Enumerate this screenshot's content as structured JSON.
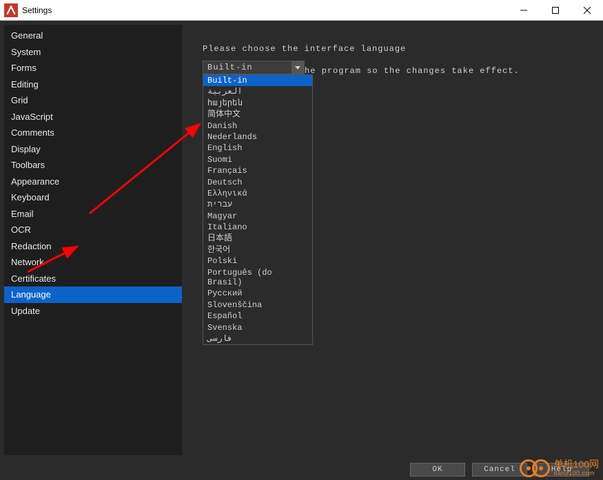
{
  "window": {
    "title": "Settings"
  },
  "sidebar": {
    "items": [
      "General",
      "System",
      "Forms",
      "Editing",
      "Grid",
      "JavaScript",
      "Comments",
      "Display",
      "Toolbars",
      "Appearance",
      "Keyboard",
      "Email",
      "OCR",
      "Redaction",
      "Network",
      "Certificates",
      "Language",
      "Update"
    ],
    "selected_index": 16
  },
  "main": {
    "prompt": "Please choose the interface language",
    "combo_value": "Built-in",
    "note": "he program so the changes take effect.",
    "dropdown": [
      "Built-in",
      "العربية",
      "հայերեն",
      "简体中文",
      "Danish",
      "Nederlands",
      "English",
      "Suomi",
      "Français",
      "Deutsch",
      "Ελληνικά",
      "עברית",
      "Magyar",
      "Italiano",
      "日本語",
      "한국어",
      "Polski",
      "Português (do Brasil)",
      "Русский",
      "Slovenščina",
      "Español",
      "Svenska",
      "فارسی"
    ],
    "dropdown_highlighted_index": 0
  },
  "footer": {
    "ok": "OK",
    "cancel": "Cancel",
    "help": "Help"
  },
  "watermark": {
    "line1": "单机100网",
    "line2": "danji100.com"
  }
}
